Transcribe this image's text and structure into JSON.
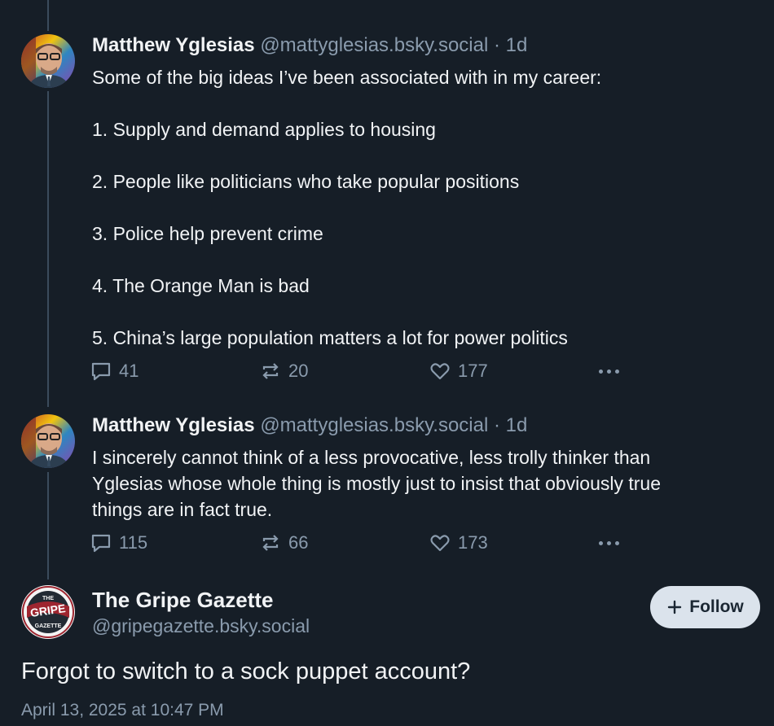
{
  "posts": [
    {
      "author_name": "Matthew Yglesias",
      "author_handle": "@mattyglesias.bsky.social",
      "separator": "·",
      "age": "1d",
      "text": "Some of the big ideas I’ve been associated with in my career:\n\n1. Supply and demand applies to housing\n\n2. People like politicians who take popular positions\n\n3. Police help prevent crime\n\n4. The Orange Man is bad\n\n5. China’s large population matters a lot for power politics",
      "replies": "41",
      "reposts": "20",
      "likes": "177"
    },
    {
      "author_name": "Matthew Yglesias",
      "author_handle": "@mattyglesias.bsky.social",
      "separator": "·",
      "age": "1d",
      "text": "I sincerely cannot think of a less provocative, less trolly thinker than\nYglesias whose whole thing is mostly just to insist that obviously true\nthings are in fact true.",
      "replies": "115",
      "reposts": "66",
      "likes": "173"
    }
  ],
  "main_post": {
    "author_name": "The Gripe Gazette",
    "author_handle": "@gripegazette.bsky.social",
    "follow_label": "Follow",
    "text": "Forgot to switch to a sock puppet account?",
    "timestamp": "April 13, 2025 at 10:47 PM",
    "avatar_logo_text": [
      "THE",
      "GRIPE",
      "GAZETTE"
    ]
  },
  "icons": {
    "reply": "speech-bubble-icon",
    "repost": "repost-arrows-icon",
    "like": "heart-icon",
    "more": "ellipsis-icon",
    "follow": "plus-icon"
  },
  "colors": {
    "background": "#161e27",
    "text": "#f1f3f5",
    "muted": "#8a9bad",
    "thread_line": "#3b4b5c",
    "follow_button_bg": "#dbe3ec",
    "gazette_red": "#9e2630"
  }
}
